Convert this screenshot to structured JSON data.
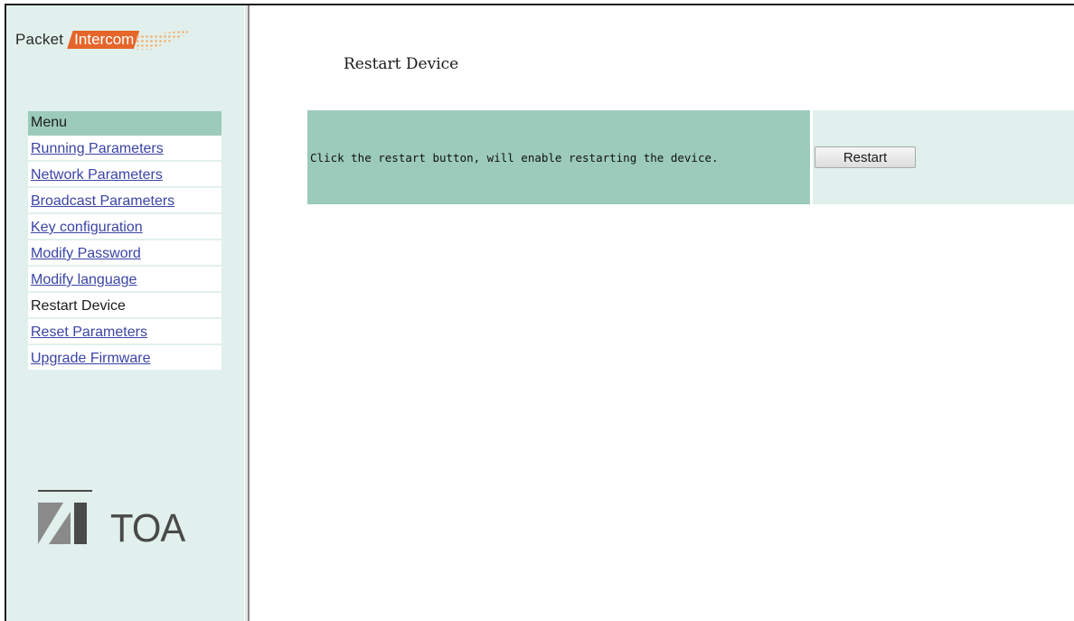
{
  "brand": {
    "packet": "Packet",
    "intercom": "Intercom"
  },
  "menu": {
    "header": "Menu",
    "items": [
      {
        "label": "Running Parameters",
        "current": false
      },
      {
        "label": "Network Parameters",
        "current": false
      },
      {
        "label": "Broadcast Parameters",
        "current": false
      },
      {
        "label": "Key configuration",
        "current": false
      },
      {
        "label": "Modify Password",
        "current": false
      },
      {
        "label": "Modify language",
        "current": false
      },
      {
        "label": "Restart Device",
        "current": true
      },
      {
        "label": "Reset Parameters",
        "current": false
      },
      {
        "label": "Upgrade Firmware",
        "current": false
      }
    ]
  },
  "logo": {
    "text": "TOA"
  },
  "page": {
    "title": "Restart Device",
    "instruction": "Click the restart button, will enable restarting the device.",
    "restart_button": "Restart"
  },
  "colors": {
    "nav_background": "#e1f0ec",
    "panel_green": "#9ccbbb",
    "brand_orange": "#e5652a",
    "link_color": "#3a44a6"
  }
}
